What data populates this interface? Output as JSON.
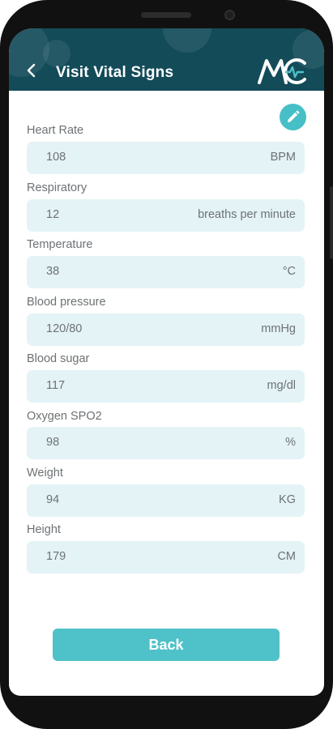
{
  "header": {
    "title": "Visit Vital Signs",
    "back_icon": "chevron-left-icon",
    "logo_text": "MC"
  },
  "edit_icon": "pencil-icon",
  "fields": [
    {
      "label": "Heart Rate",
      "value": "108",
      "unit": "BPM"
    },
    {
      "label": "Respiratory",
      "value": "12",
      "unit": "breaths per minute"
    },
    {
      "label": "Temperature",
      "value": "38",
      "unit": "°C"
    },
    {
      "label": "Blood pressure",
      "value": "120/80",
      "unit": "mmHg"
    },
    {
      "label": "Blood sugar",
      "value": "117",
      "unit": "mg/dl"
    },
    {
      "label": "Oxygen SPO2",
      "value": "98",
      "unit": "%"
    },
    {
      "label": "Weight",
      "value": "94",
      "unit": "KG"
    },
    {
      "label": "Height",
      "value": "179",
      "unit": "CM"
    }
  ],
  "back_button": {
    "label": "Back"
  },
  "colors": {
    "header": "#134b59",
    "accent": "#4fc1c9",
    "field_bg": "#e4f3f6",
    "text": "#6d7275"
  }
}
